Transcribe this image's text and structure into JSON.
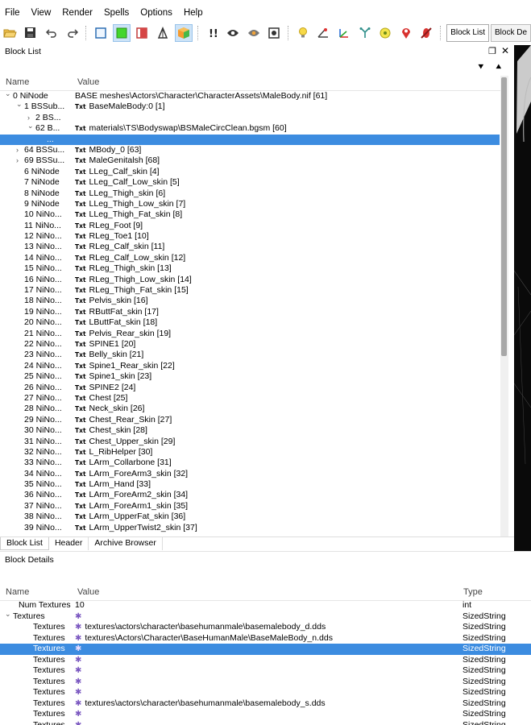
{
  "menu": [
    "File",
    "View",
    "Render",
    "Spells",
    "Options",
    "Help"
  ],
  "toolbar": {
    "block_list_btn": "Block List",
    "block_details_btn": "Block De"
  },
  "block_list": {
    "title": "Block List",
    "columns": {
      "name": "Name",
      "value": "Value"
    },
    "rows": [
      {
        "indent": 0,
        "arrow": "v",
        "name": "0 NiNode",
        "value": "BASE meshes\\Actors\\Character\\CharacterAssets\\MaleBody.nif [61]",
        "txt": false
      },
      {
        "indent": 1,
        "arrow": "v",
        "name": "1 BSSub...",
        "value": "BaseMaleBody:0 [1]",
        "txt": true
      },
      {
        "indent": 2,
        "arrow": ">",
        "name": "2 BS...",
        "value": "",
        "txt": false
      },
      {
        "indent": 2,
        "arrow": "v",
        "name": "62 B...",
        "value": "materials\\TS\\Bodyswap\\BSMaleCircClean.bgsm [60]",
        "txt": true
      },
      {
        "indent": 3,
        "arrow": "",
        "name": "...",
        "value": "",
        "txt": false,
        "selected": true
      },
      {
        "indent": 1,
        "arrow": ">",
        "name": "64 BSSu...",
        "value": "MBody_0 [63]",
        "txt": true
      },
      {
        "indent": 1,
        "arrow": ">",
        "name": "69 BSSu...",
        "value": "MaleGenitalsh [68]",
        "txt": true
      },
      {
        "indent": 1,
        "arrow": "",
        "name": "6 NiNode",
        "value": "LLeg_Calf_skin [4]",
        "txt": true
      },
      {
        "indent": 1,
        "arrow": "",
        "name": "7 NiNode",
        "value": "LLeg_Calf_Low_skin [5]",
        "txt": true
      },
      {
        "indent": 1,
        "arrow": "",
        "name": "8 NiNode",
        "value": "LLeg_Thigh_skin [6]",
        "txt": true
      },
      {
        "indent": 1,
        "arrow": "",
        "name": "9 NiNode",
        "value": "LLeg_Thigh_Low_skin [7]",
        "txt": true
      },
      {
        "indent": 1,
        "arrow": "",
        "name": "10 NiNo...",
        "value": "LLeg_Thigh_Fat_skin [8]",
        "txt": true
      },
      {
        "indent": 1,
        "arrow": "",
        "name": "11 NiNo...",
        "value": "RLeg_Foot [9]",
        "txt": true
      },
      {
        "indent": 1,
        "arrow": "",
        "name": "12 NiNo...",
        "value": "RLeg_Toe1 [10]",
        "txt": true
      },
      {
        "indent": 1,
        "arrow": "",
        "name": "13 NiNo...",
        "value": "RLeg_Calf_skin [11]",
        "txt": true
      },
      {
        "indent": 1,
        "arrow": "",
        "name": "14 NiNo...",
        "value": "RLeg_Calf_Low_skin [12]",
        "txt": true
      },
      {
        "indent": 1,
        "arrow": "",
        "name": "15 NiNo...",
        "value": "RLeg_Thigh_skin [13]",
        "txt": true
      },
      {
        "indent": 1,
        "arrow": "",
        "name": "16 NiNo...",
        "value": "RLeg_Thigh_Low_skin [14]",
        "txt": true
      },
      {
        "indent": 1,
        "arrow": "",
        "name": "17 NiNo...",
        "value": "RLeg_Thigh_Fat_skin [15]",
        "txt": true
      },
      {
        "indent": 1,
        "arrow": "",
        "name": "18 NiNo...",
        "value": "Pelvis_skin [16]",
        "txt": true
      },
      {
        "indent": 1,
        "arrow": "",
        "name": "19 NiNo...",
        "value": "RButtFat_skin [17]",
        "txt": true
      },
      {
        "indent": 1,
        "arrow": "",
        "name": "20 NiNo...",
        "value": "LButtFat_skin [18]",
        "txt": true
      },
      {
        "indent": 1,
        "arrow": "",
        "name": "21 NiNo...",
        "value": "Pelvis_Rear_skin [19]",
        "txt": true
      },
      {
        "indent": 1,
        "arrow": "",
        "name": "22 NiNo...",
        "value": "SPINE1 [20]",
        "txt": true
      },
      {
        "indent": 1,
        "arrow": "",
        "name": "23 NiNo...",
        "value": "Belly_skin [21]",
        "txt": true
      },
      {
        "indent": 1,
        "arrow": "",
        "name": "24 NiNo...",
        "value": "Spine1_Rear_skin [22]",
        "txt": true
      },
      {
        "indent": 1,
        "arrow": "",
        "name": "25 NiNo...",
        "value": "Spine1_skin [23]",
        "txt": true
      },
      {
        "indent": 1,
        "arrow": "",
        "name": "26 NiNo...",
        "value": "SPINE2 [24]",
        "txt": true
      },
      {
        "indent": 1,
        "arrow": "",
        "name": "27 NiNo...",
        "value": "Chest [25]",
        "txt": true
      },
      {
        "indent": 1,
        "arrow": "",
        "name": "28 NiNo...",
        "value": "Neck_skin [26]",
        "txt": true
      },
      {
        "indent": 1,
        "arrow": "",
        "name": "29 NiNo...",
        "value": "Chest_Rear_Skin [27]",
        "txt": true
      },
      {
        "indent": 1,
        "arrow": "",
        "name": "30 NiNo...",
        "value": "Chest_skin [28]",
        "txt": true
      },
      {
        "indent": 1,
        "arrow": "",
        "name": "31 NiNo...",
        "value": "Chest_Upper_skin [29]",
        "txt": true
      },
      {
        "indent": 1,
        "arrow": "",
        "name": "32 NiNo...",
        "value": "L_RibHelper [30]",
        "txt": true
      },
      {
        "indent": 1,
        "arrow": "",
        "name": "33 NiNo...",
        "value": "LArm_Collarbone [31]",
        "txt": true
      },
      {
        "indent": 1,
        "arrow": "",
        "name": "34 NiNo...",
        "value": "LArm_ForeArm3_skin [32]",
        "txt": true
      },
      {
        "indent": 1,
        "arrow": "",
        "name": "35 NiNo...",
        "value": "LArm_Hand [33]",
        "txt": true
      },
      {
        "indent": 1,
        "arrow": "",
        "name": "36 NiNo...",
        "value": "LArm_ForeArm2_skin [34]",
        "txt": true
      },
      {
        "indent": 1,
        "arrow": "",
        "name": "37 NiNo...",
        "value": "LArm_ForeArm1_skin [35]",
        "txt": true
      },
      {
        "indent": 1,
        "arrow": "",
        "name": "38 NiNo...",
        "value": "LArm_UpperFat_skin [36]",
        "txt": true
      },
      {
        "indent": 1,
        "arrow": "",
        "name": "39 NiNo...",
        "value": "LArm_UpperTwist2_skin [37]",
        "txt": true
      }
    ]
  },
  "tabs": [
    "Block List",
    "Header",
    "Archive Browser"
  ],
  "block_details": {
    "title": "Block Details",
    "columns": {
      "name": "Name",
      "value": "Value",
      "type": "Type"
    },
    "rows": [
      {
        "indent": 1,
        "arrow": "",
        "name": "Num Textures",
        "value": "10",
        "type": "int",
        "icon": false
      },
      {
        "indent": 0,
        "arrow": "v",
        "name": "Textures",
        "value": "",
        "type": "SizedString",
        "icon": true
      },
      {
        "indent": 2,
        "arrow": "",
        "name": "Textures",
        "value": "textures\\actors\\character\\basehumanmale\\basemalebody_d.dds",
        "type": "SizedString",
        "icon": true
      },
      {
        "indent": 2,
        "arrow": "",
        "name": "Textures",
        "value": "textures\\Actors\\Character\\BaseHumanMale\\BaseMaleBody_n.dds",
        "type": "SizedString",
        "icon": true
      },
      {
        "indent": 2,
        "arrow": "",
        "name": "Textures",
        "value": "",
        "type": "SizedString",
        "icon": true,
        "selected": true
      },
      {
        "indent": 2,
        "arrow": "",
        "name": "Textures",
        "value": "",
        "type": "SizedString",
        "icon": true
      },
      {
        "indent": 2,
        "arrow": "",
        "name": "Textures",
        "value": "",
        "type": "SizedString",
        "icon": true
      },
      {
        "indent": 2,
        "arrow": "",
        "name": "Textures",
        "value": "",
        "type": "SizedString",
        "icon": true
      },
      {
        "indent": 2,
        "arrow": "",
        "name": "Textures",
        "value": "",
        "type": "SizedString",
        "icon": true
      },
      {
        "indent": 2,
        "arrow": "",
        "name": "Textures",
        "value": "textures\\actors\\character\\basehumanmale\\basemalebody_s.dds",
        "type": "SizedString",
        "icon": true
      },
      {
        "indent": 2,
        "arrow": "",
        "name": "Textures",
        "value": "",
        "type": "SizedString",
        "icon": true
      },
      {
        "indent": 2,
        "arrow": "",
        "name": "Textures",
        "value": "",
        "type": "SizedString",
        "icon": true
      }
    ]
  },
  "colors": {
    "selection": "#3c8ce0",
    "viewport": "#0a0a0a"
  }
}
